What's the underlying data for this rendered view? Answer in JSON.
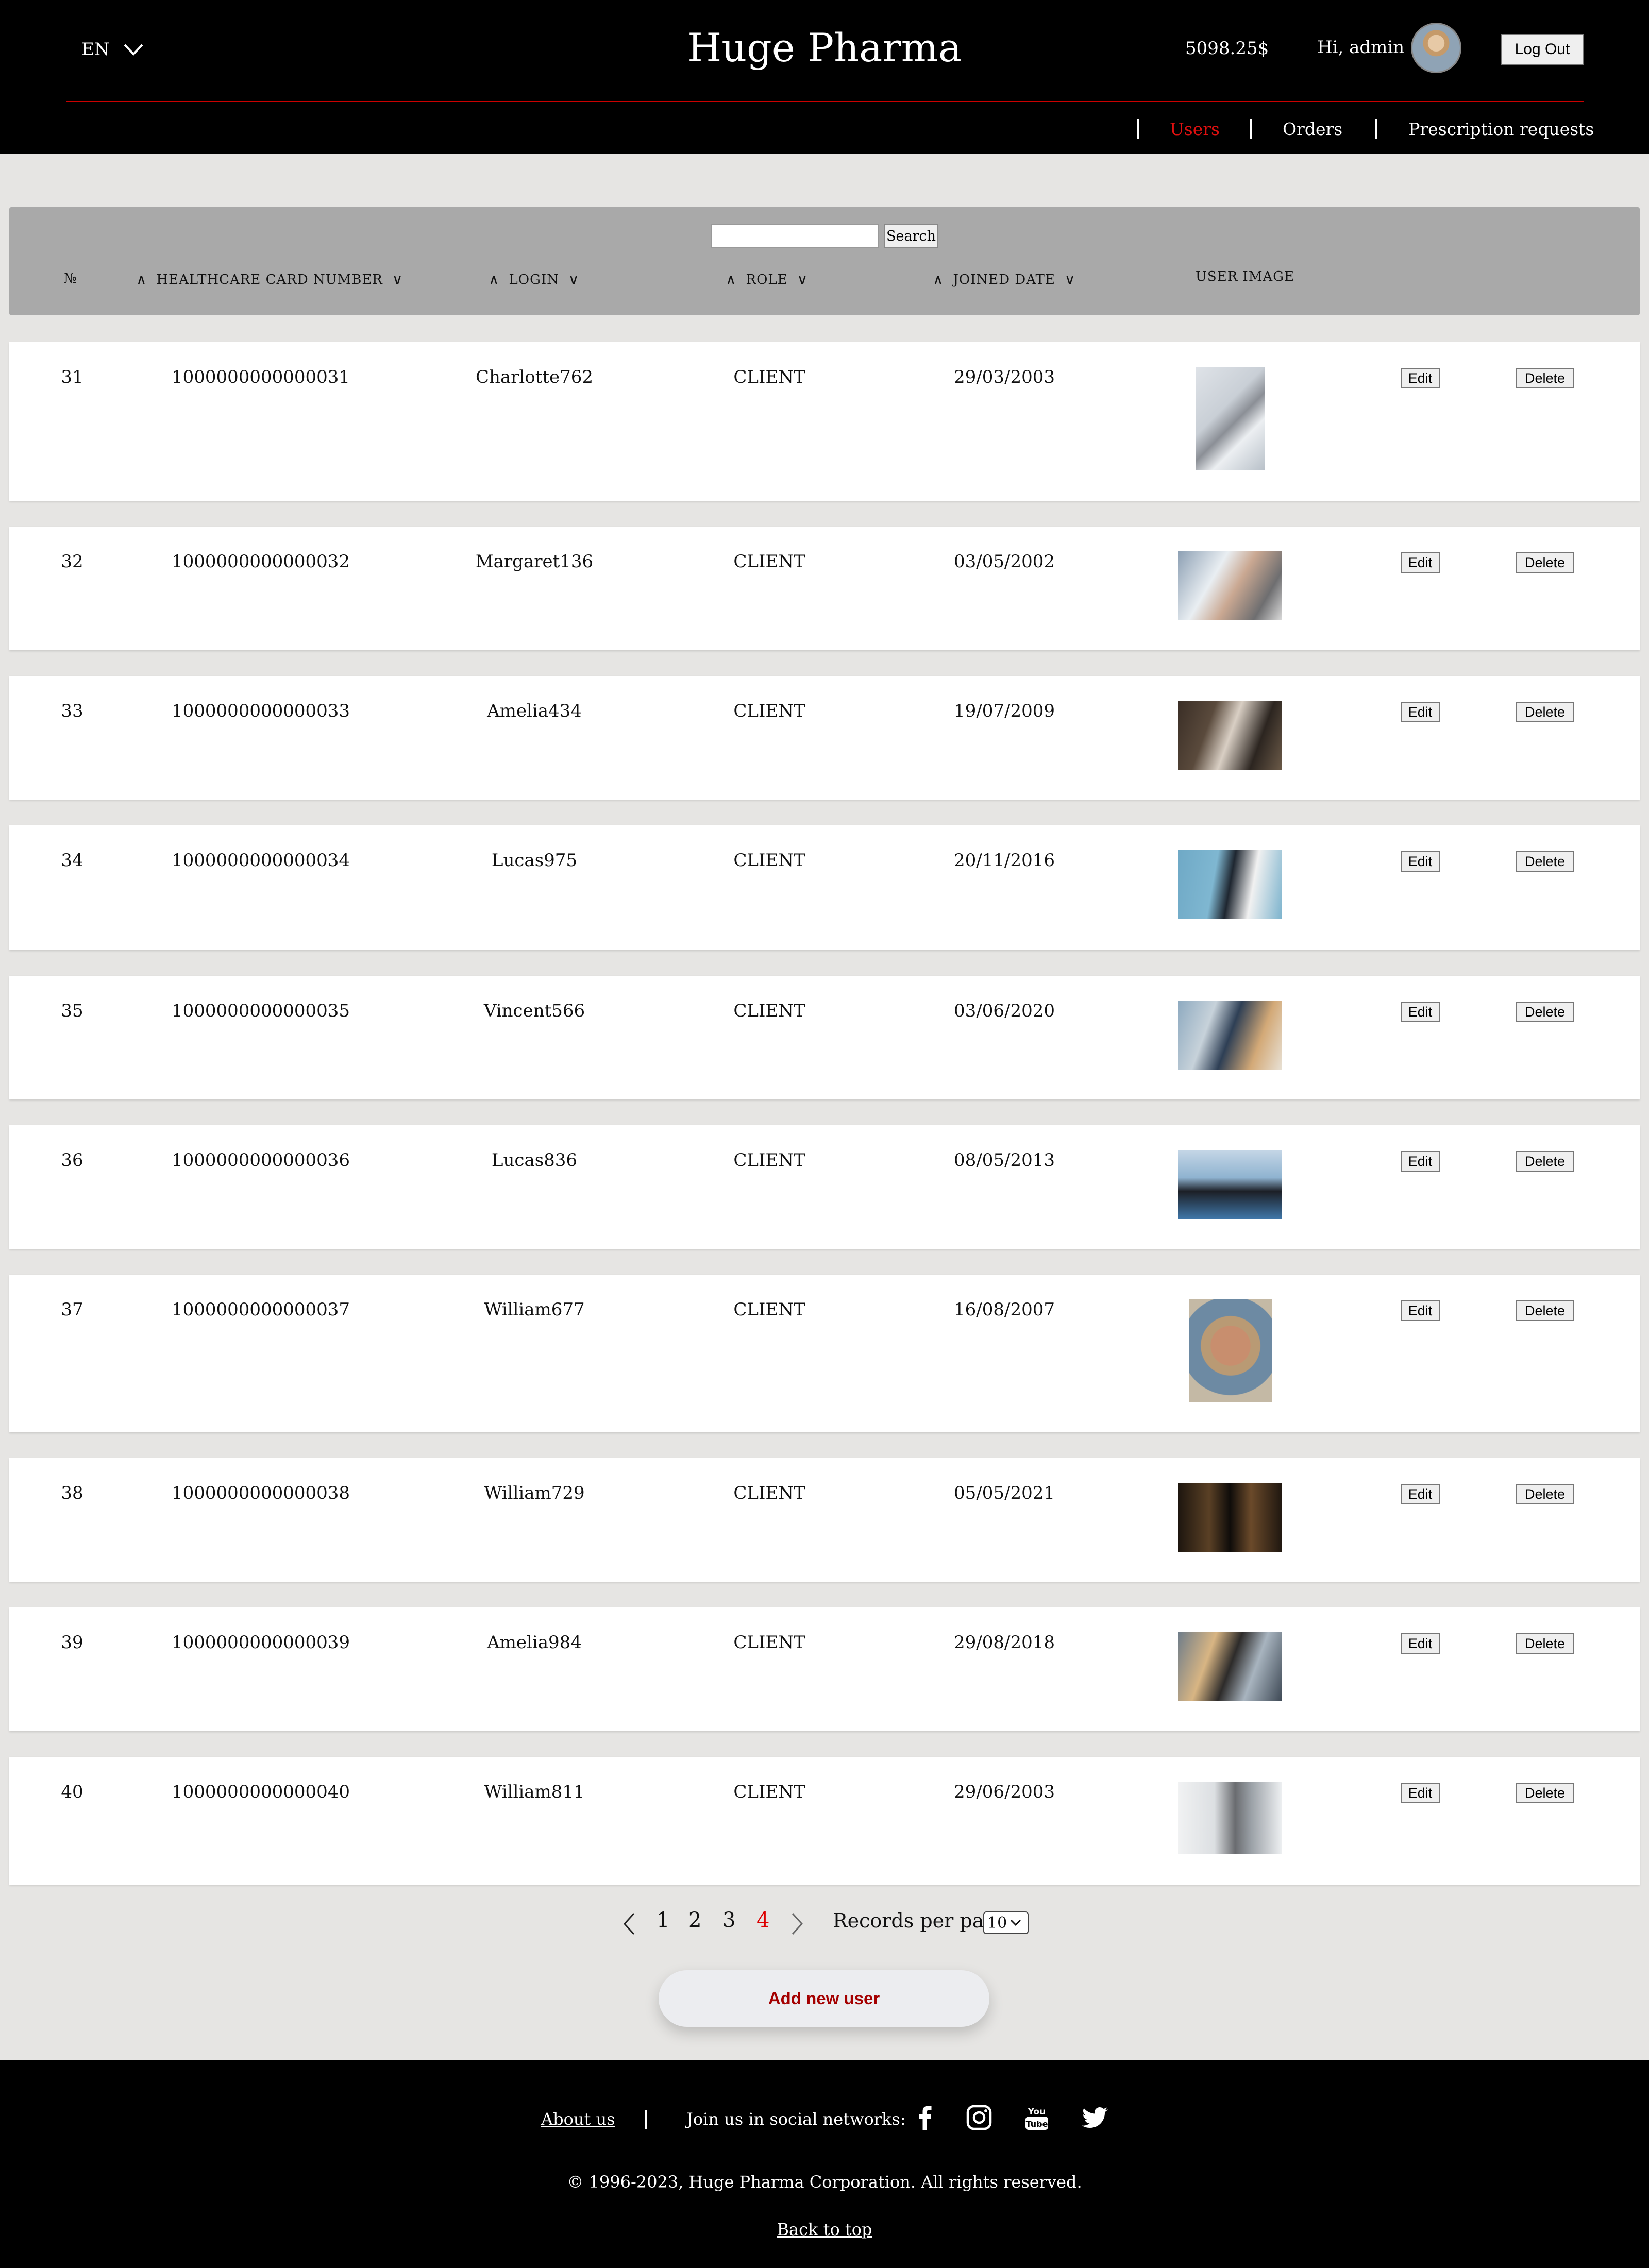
{
  "header": {
    "language": "EN",
    "brand": "Huge Pharma",
    "balance": "5098.25$",
    "greeting": "Hi, admin",
    "logout_label": "Log Out"
  },
  "nav": {
    "items": [
      {
        "label": "Users",
        "active": true
      },
      {
        "label": "Orders",
        "active": false
      },
      {
        "label": "Prescription requests",
        "active": false
      }
    ]
  },
  "search": {
    "value": "",
    "button_label": "Search"
  },
  "table": {
    "columns": [
      "№",
      "HEALTHCARE CARD NUMBER",
      "LOGIN",
      "ROLE",
      "JOINED DATE",
      "USER IMAGE"
    ],
    "rows": [
      {
        "no": "31",
        "card": "1000000000000031",
        "login": "Charlotte762",
        "role": "CLIENT",
        "joined": "29/03/2003"
      },
      {
        "no": "32",
        "card": "1000000000000032",
        "login": "Margaret136",
        "role": "CLIENT",
        "joined": "03/05/2002"
      },
      {
        "no": "33",
        "card": "1000000000000033",
        "login": "Amelia434",
        "role": "CLIENT",
        "joined": "19/07/2009"
      },
      {
        "no": "34",
        "card": "1000000000000034",
        "login": "Lucas975",
        "role": "CLIENT",
        "joined": "20/11/2016"
      },
      {
        "no": "35",
        "card": "1000000000000035",
        "login": "Vincent566",
        "role": "CLIENT",
        "joined": "03/06/2020"
      },
      {
        "no": "36",
        "card": "1000000000000036",
        "login": "Lucas836",
        "role": "CLIENT",
        "joined": "08/05/2013"
      },
      {
        "no": "37",
        "card": "1000000000000037",
        "login": "William677",
        "role": "CLIENT",
        "joined": "16/08/2007"
      },
      {
        "no": "38",
        "card": "1000000000000038",
        "login": "William729",
        "role": "CLIENT",
        "joined": "05/05/2021"
      },
      {
        "no": "39",
        "card": "1000000000000039",
        "login": "Amelia984",
        "role": "CLIENT",
        "joined": "29/08/2018"
      },
      {
        "no": "40",
        "card": "1000000000000040",
        "login": "William811",
        "role": "CLIENT",
        "joined": "29/06/2003"
      }
    ],
    "edit_label": "Edit",
    "delete_label": "Delete"
  },
  "pagination": {
    "pages": [
      "1",
      "2",
      "3",
      "4"
    ],
    "current": "4",
    "records_label": "Records per page:",
    "records_value": "10"
  },
  "add_button": "Add new user",
  "footer": {
    "about": "About us",
    "join": "Join us in social networks:",
    "social_icons": [
      "facebook-icon",
      "instagram-icon",
      "youtube-icon",
      "twitter-icon"
    ],
    "copyright": "© 1996-2023, Huge Pharma Corporation. All rights reserved.",
    "back_to_top": "Back to top"
  },
  "colors": {
    "accent": "#e01010",
    "header_bg": "#000000",
    "table_header_bg": "#a9a9a9",
    "page_bg": "#e6e5e3"
  }
}
